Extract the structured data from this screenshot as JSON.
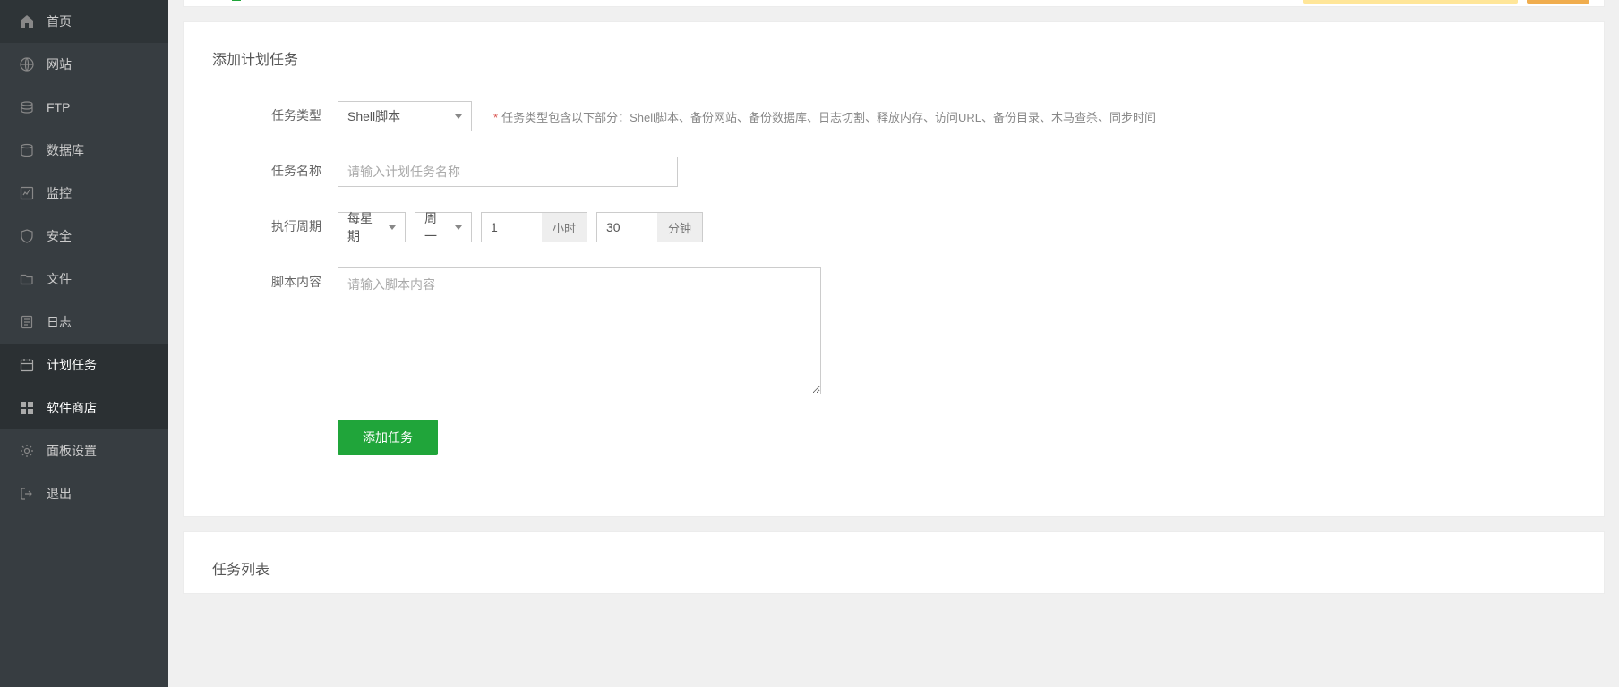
{
  "sidebar": {
    "items": [
      {
        "icon": "home-icon",
        "label": "首页"
      },
      {
        "icon": "globe-icon",
        "label": "网站"
      },
      {
        "icon": "ftp-icon",
        "label": "FTP"
      },
      {
        "icon": "database-icon",
        "label": "数据库"
      },
      {
        "icon": "monitor-icon",
        "label": "监控"
      },
      {
        "icon": "shield-icon",
        "label": "安全"
      },
      {
        "icon": "folder-icon",
        "label": "文件"
      },
      {
        "icon": "log-icon",
        "label": "日志"
      },
      {
        "icon": "calendar-icon",
        "label": "计划任务"
      },
      {
        "icon": "apps-icon",
        "label": "软件商店"
      },
      {
        "icon": "gear-icon",
        "label": "面板设置"
      },
      {
        "icon": "exit-icon",
        "label": "退出"
      }
    ]
  },
  "panel": {
    "title": "添加计划任务",
    "list_title": "任务列表"
  },
  "form": {
    "task_type_label": "任务类型",
    "task_type_value": "Shell脚本",
    "task_type_hint": "任务类型包含以下部分：Shell脚本、备份网站、备份数据库、日志切割、释放内存、访问URL、备份目录、木马查杀、同步时间",
    "task_name_label": "任务名称",
    "task_name_placeholder": "请输入计划任务名称",
    "task_name_value": "",
    "cycle_label": "执行周期",
    "cycle_type_value": "每星期",
    "cycle_day_value": "周一",
    "cycle_hour_value": "1",
    "cycle_hour_unit": "小时",
    "cycle_minute_value": "30",
    "cycle_minute_unit": "分钟",
    "script_label": "脚本内容",
    "script_placeholder": "请输入脚本内容",
    "script_value": "",
    "submit_label": "添加任务"
  }
}
